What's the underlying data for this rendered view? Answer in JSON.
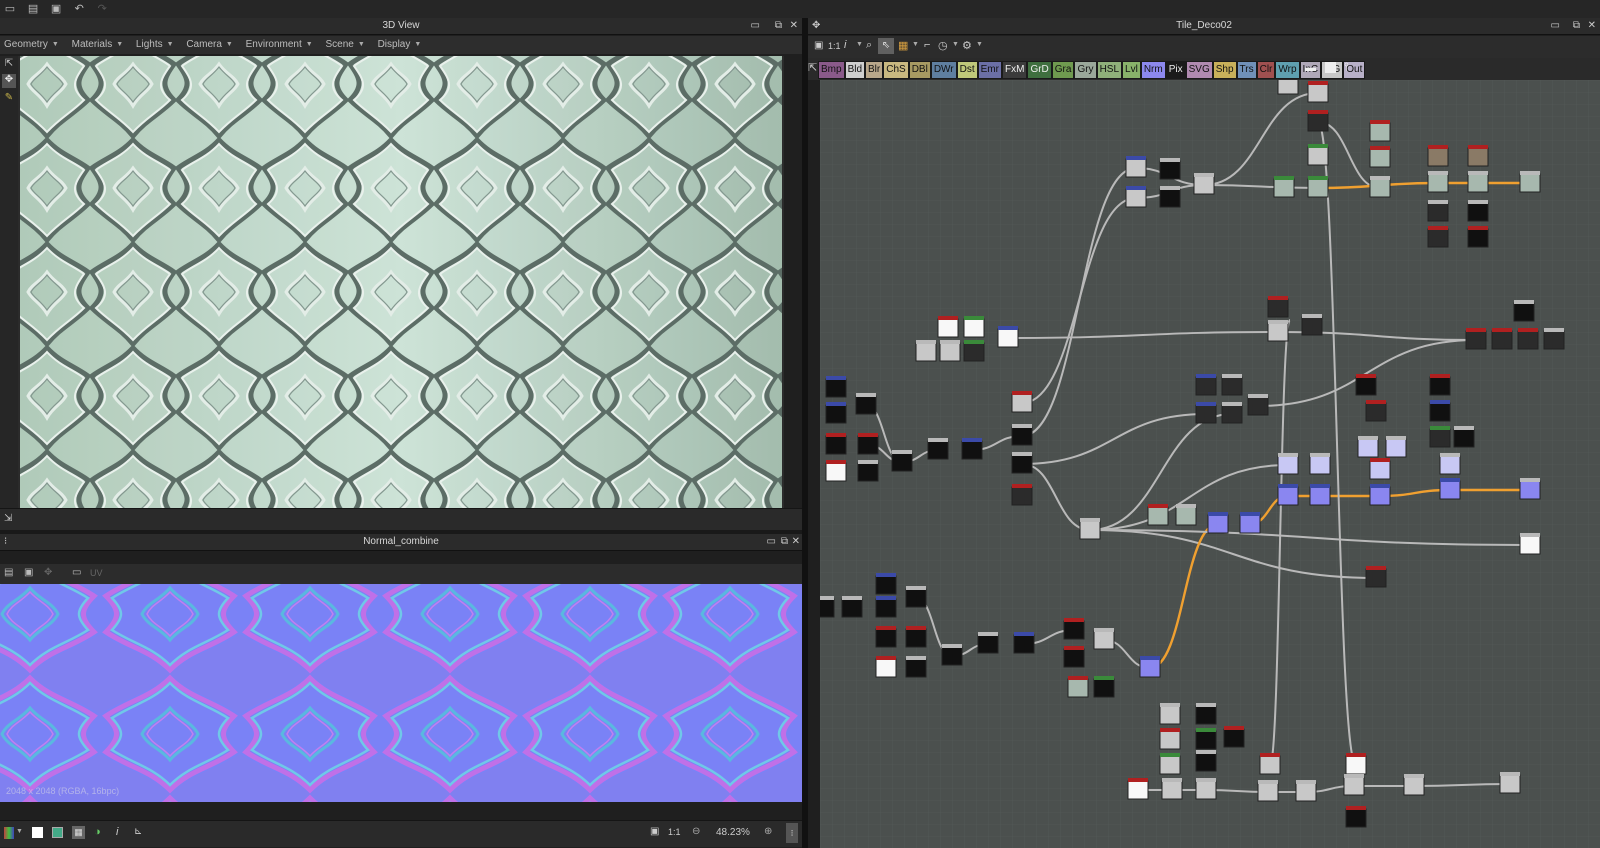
{
  "app_toolbar": {
    "icons": [
      "new-file-icon",
      "open-file-icon",
      "save-file-icon",
      "undo-icon",
      "redo-icon"
    ]
  },
  "view3d": {
    "title": "3D View",
    "menus": [
      "Geometry",
      "Materials",
      "Lights",
      "Camera",
      "Environment",
      "Scene",
      "Display"
    ]
  },
  "normal_view": {
    "title": "Normal_combine",
    "uv_label": "UV",
    "image_info": "2048 x 2048 (RGBA, 16bpc)",
    "ratio_label": "1:1",
    "zoom": "48.23%"
  },
  "graph": {
    "title": "Tile_Deco02",
    "toolbar_ratio": "1:1",
    "categories": [
      {
        "label": "Bmp",
        "color": "#8a5a8a"
      },
      {
        "label": "Bld",
        "color": "#cfcfcf"
      },
      {
        "label": "Blr",
        "color": "#b9a78a"
      },
      {
        "label": "ChS",
        "color": "#c9b880"
      },
      {
        "label": "DBl",
        "color": "#a79a62"
      },
      {
        "label": "DWr",
        "color": "#5f7fa0"
      },
      {
        "label": "Dst",
        "color": "#bfc87a"
      },
      {
        "label": "Emr",
        "color": "#6b6fa6"
      },
      {
        "label": "FxM",
        "color": "#3b3b3b"
      },
      {
        "label": "GrD",
        "color": "#3f6f3f"
      },
      {
        "label": "Gra",
        "color": "#6f9a4f"
      },
      {
        "label": "Gry",
        "color": "#9aa89a"
      },
      {
        "label": "HSL",
        "color": "#8fb07a"
      },
      {
        "label": "Lvl",
        "color": "#88b26a"
      },
      {
        "label": "Nrm",
        "color": "#8c88ee"
      },
      {
        "label": "Pix",
        "color": "#1a1a1a"
      },
      {
        "label": "SVG",
        "color": "#b08ab0"
      },
      {
        "label": "Shp",
        "color": "#c8b05a"
      },
      {
        "label": "Trs",
        "color": "#7090b8"
      },
      {
        "label": "Clr",
        "color": "#a05050"
      },
      {
        "label": "Wrp",
        "color": "#5fa0b0"
      },
      {
        "label": "InC",
        "color": "#b0a8b8"
      },
      {
        "label": "InG",
        "color": "#c8c8c8"
      },
      {
        "label": "Out",
        "color": "#b8b0c8"
      }
    ]
  },
  "colors": {
    "panel_bg": "#2b2b2b",
    "graph_bg": "#4a4e4c",
    "wire": "#b9b9b9",
    "wire_active": "#f0a030",
    "header_red": "#b02020",
    "header_green": "#3a8a3a",
    "header_blue": "#3b4aa8"
  }
}
